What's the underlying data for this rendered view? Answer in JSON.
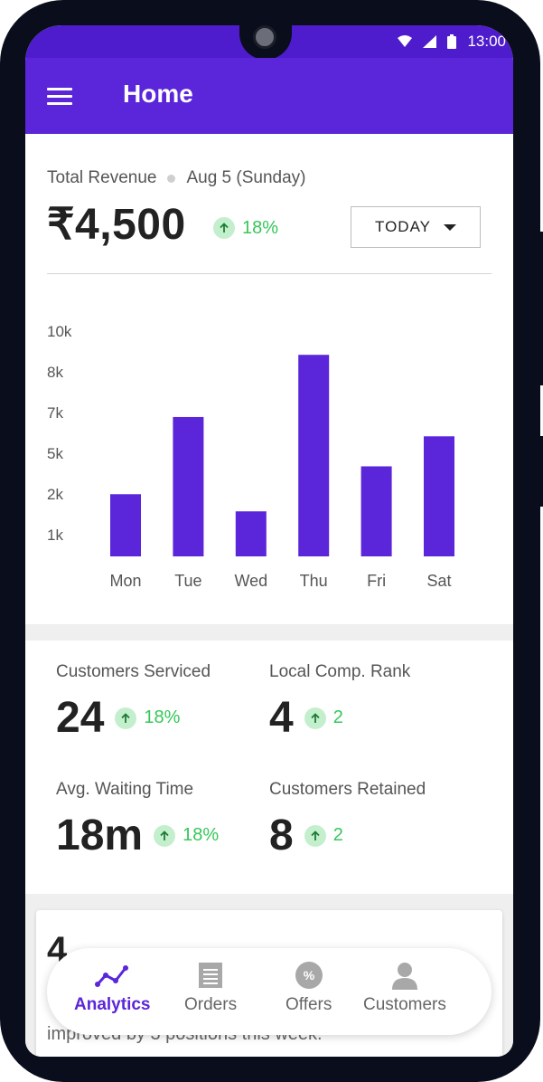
{
  "status_bar": {
    "time": "13:00",
    "icons": [
      "wifi-icon",
      "signal-icon",
      "battery-icon"
    ]
  },
  "app_bar": {
    "title": "Home",
    "menu_icon": "hamburger-menu-icon"
  },
  "revenue": {
    "label": "Total Revenue",
    "date": "Aug 5 (Sunday)",
    "amount": "₹4,500",
    "change": "18%",
    "range_button": "TODAY"
  },
  "chart_data": {
    "type": "bar",
    "categories": [
      "Mon",
      "Tue",
      "Wed",
      "Thu",
      "Fri",
      "Sat"
    ],
    "values": [
      2900,
      6500,
      2100,
      9400,
      4200,
      5600
    ],
    "y_tick_labels": [
      "10k",
      "8k",
      "7k",
      "5k",
      "2k",
      "1k"
    ],
    "ylim": [
      0,
      10000
    ],
    "color": "#5b25da",
    "title": "",
    "xlabel": "",
    "ylabel": ""
  },
  "stats": [
    {
      "label": "Customers Serviced",
      "value": "24",
      "change": "18%"
    },
    {
      "label": "Local Comp. Rank",
      "value": "4",
      "change": "2"
    },
    {
      "label": "Avg. Waiting Time",
      "value": "18m",
      "change": "18%"
    },
    {
      "label": "Customers Retained",
      "value": "8",
      "change": "2"
    }
  ],
  "card": {
    "number": "4",
    "text": "improved by 3 positions this week."
  },
  "bottom_nav": {
    "items": [
      {
        "label": "Analytics",
        "icon": "analytics-line-icon",
        "active": true
      },
      {
        "label": "Orders",
        "icon": "receipt-icon",
        "active": false
      },
      {
        "label": "Offers",
        "icon": "percent-badge-icon",
        "active": false
      },
      {
        "label": "Customers",
        "icon": "person-icon",
        "active": false
      }
    ]
  },
  "colors": {
    "primary": "#5b25da",
    "positive": "#35c759",
    "positive_bg": "#c4efcd"
  }
}
